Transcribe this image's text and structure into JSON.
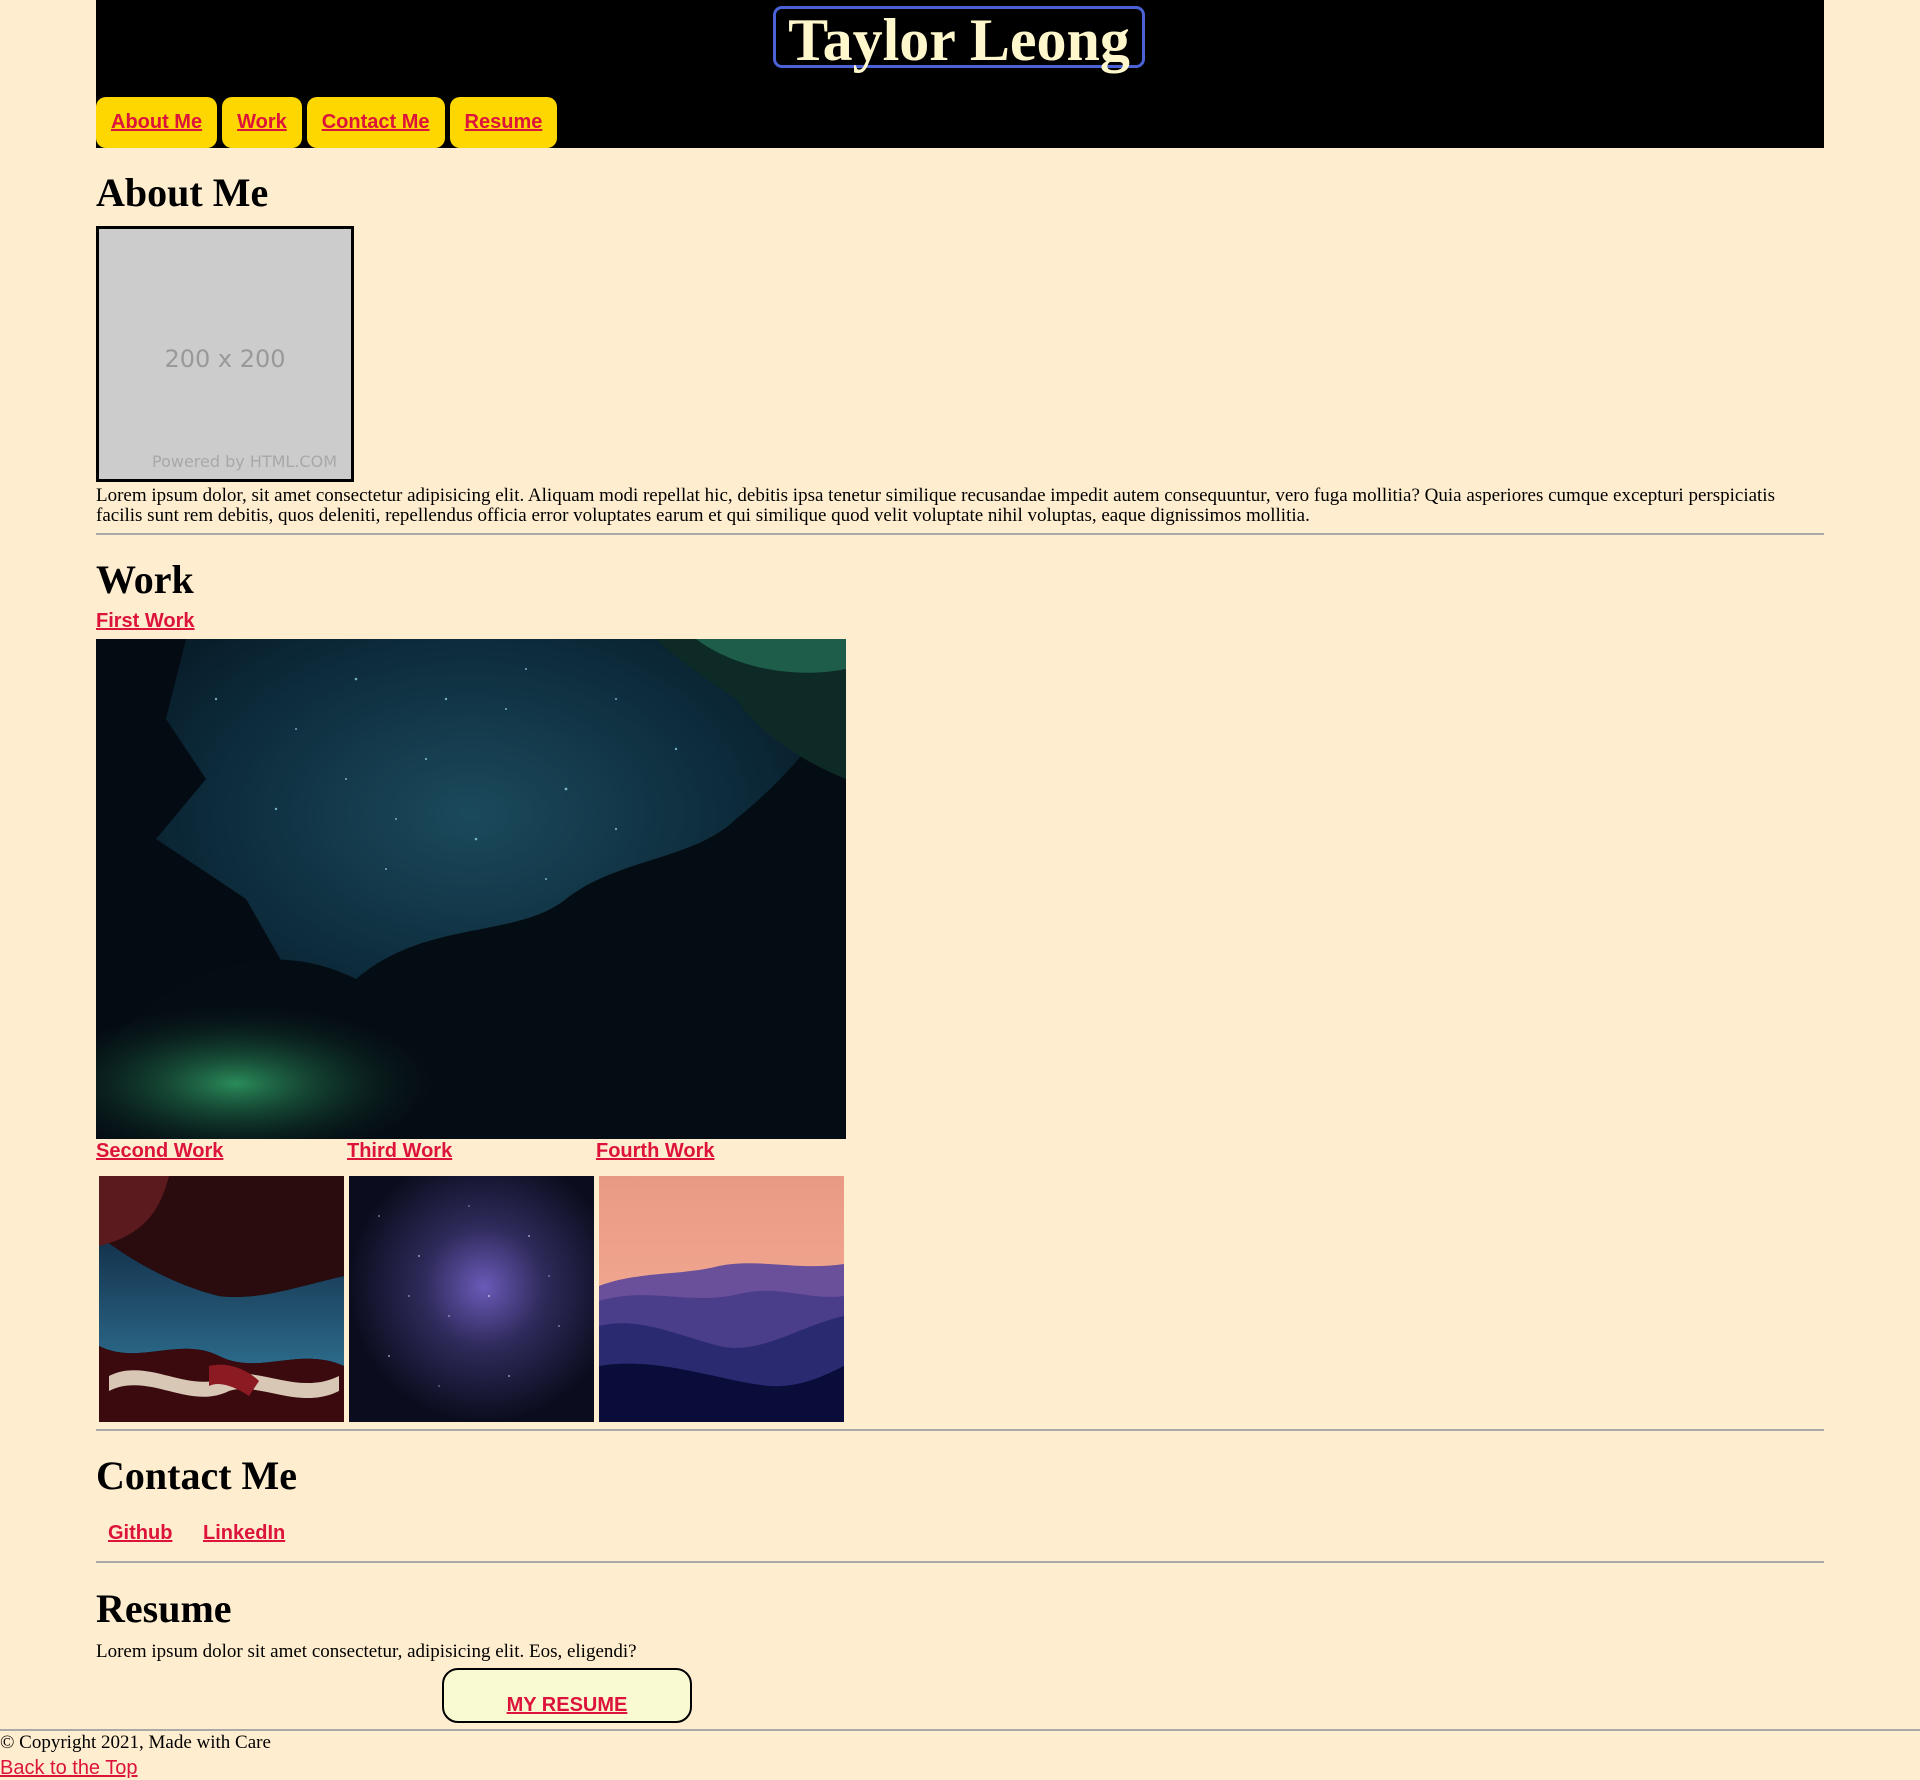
{
  "header": {
    "title": "Taylor Leong",
    "nav": [
      {
        "label": "About Me"
      },
      {
        "label": "Work"
      },
      {
        "label": "Contact Me"
      },
      {
        "label": "Resume"
      }
    ]
  },
  "about": {
    "heading": "About Me",
    "placeholder_size": "200 x 200",
    "placeholder_credit": "Powered by HTML.COM",
    "text": "Lorem ipsum dolor, sit amet consectetur adipisicing elit. Aliquam modi repellat hic, debitis ipsa tenetur similique recusandae impedit autem consequuntur, vero fuga mollitia? Quia asperiores cumque excepturi perspiciatis facilis sunt rem debitis, quos deleniti, repellendus officia error voluptates earum et qui similique quod velit voluptate nihil voluptas, eaque dignissimos mollitia."
  },
  "work": {
    "heading": "Work",
    "items": [
      {
        "label": "First Work"
      },
      {
        "label": "Second Work"
      },
      {
        "label": "Third Work"
      },
      {
        "label": "Fourth Work"
      }
    ]
  },
  "contact": {
    "heading": "Contact Me",
    "links": [
      {
        "label": "Github"
      },
      {
        "label": "LinkedIn"
      }
    ]
  },
  "resume": {
    "heading": "Resume",
    "text": "Lorem ipsum dolor sit amet consectetur, adipisicing elit. Eos, eligendi?",
    "button_label": "MY RESUME"
  },
  "footer": {
    "copyright": "© Copyright 2021, Made with Care",
    "back_to_top": "Back to the Top"
  },
  "colors": {
    "background": "#ffedcf",
    "header": "#000000",
    "nav_button": "#ffd700",
    "link": "#dc143c",
    "title_text": "#fff7cc",
    "title_border": "#4a62d6",
    "resume_button": "#fafad2"
  }
}
